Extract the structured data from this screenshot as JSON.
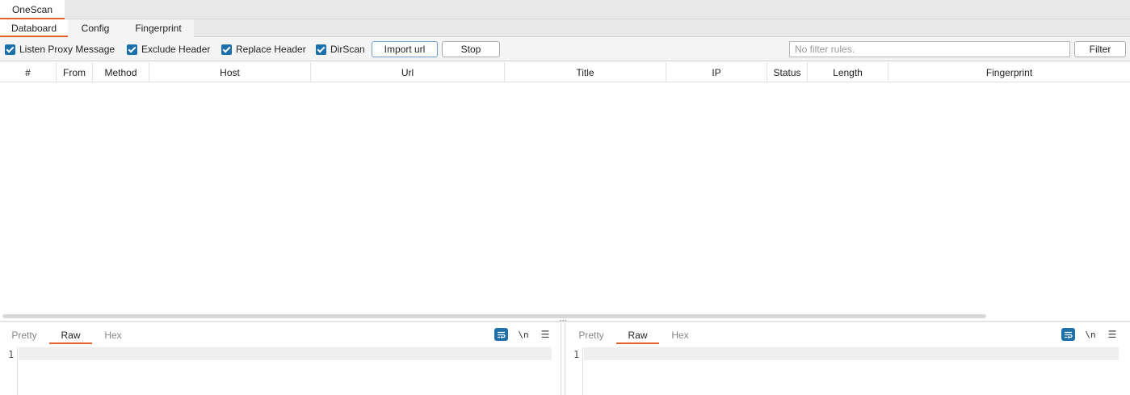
{
  "top_tabs": {
    "onescan": "OneScan"
  },
  "sub_tabs": {
    "databoard": "Databoard",
    "config": "Config",
    "fingerprint": "Fingerprint"
  },
  "toolbar": {
    "listen_proxy": "Listen Proxy Message",
    "exclude_header": "Exclude Header",
    "replace_header": "Replace Header",
    "dirscan": "DirScan",
    "import_url": "Import url",
    "stop": "Stop",
    "filter_placeholder": "No filter rules.",
    "filter": "Filter"
  },
  "table": {
    "columns": [
      "#",
      "From",
      "Method",
      "Host",
      "Url",
      "Title",
      "IP",
      "Status",
      "Length",
      "Fingerprint"
    ]
  },
  "request_pane": {
    "pretty": "Pretty",
    "raw": "Raw",
    "hex": "Hex",
    "newline": "\\n",
    "line_number": "1"
  },
  "response_pane": {
    "pretty": "Pretty",
    "raw": "Raw",
    "hex": "Hex",
    "newline": "\\n",
    "line_number": "1"
  },
  "colors": {
    "accent": "#e8612c",
    "checkbox": "#1a6fad"
  }
}
